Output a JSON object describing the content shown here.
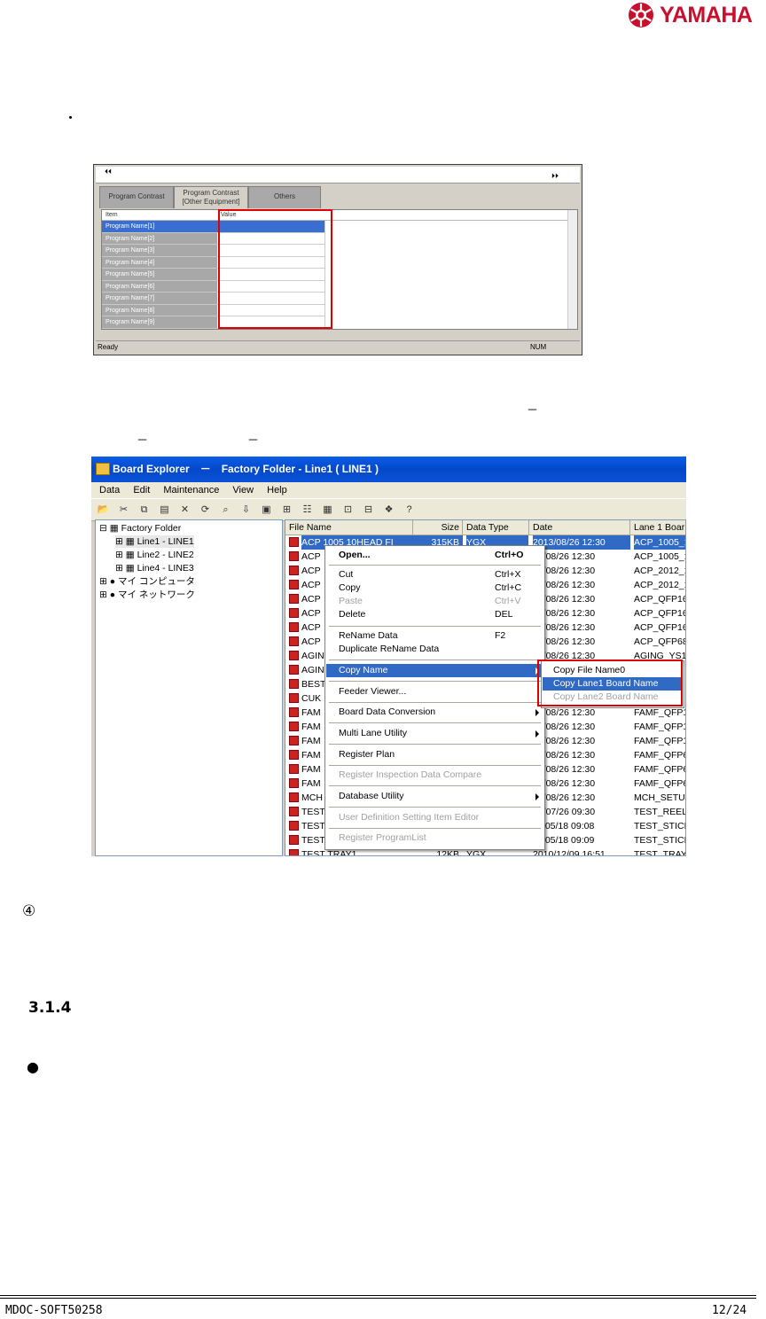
{
  "header": {
    "logo_text": "YAMAHA",
    "logo_icon": "tuning-forks-emblem",
    "brand_color": "#c8102e"
  },
  "body": {
    "bullet1": "・",
    "step_marker": "④",
    "section_number": "3.1.4",
    "bullet2": "●",
    "dash1": "－",
    "dash2": "－",
    "dash3": "－"
  },
  "screenshot1": {
    "tabs": [
      "Program Contrast",
      "Program Contrast\n[Other Equipment]",
      "Others"
    ],
    "col_item": "Item",
    "col_value": "Value",
    "rows": [
      "Program Name[1]",
      "Program Name[2]",
      "Program Name[3]",
      "Program Name[4]",
      "Program Name[5]",
      "Program Name[6]",
      "Program Name[7]",
      "Program Name[8]",
      "Program Name[9]"
    ],
    "status": "Ready",
    "status_num": "NUM"
  },
  "screenshot2": {
    "title": "Board Explorer　－　Factory Folder - Line1 ( LINE1 )",
    "menu": [
      "Data",
      "Edit",
      "Maintenance",
      "View",
      "Help"
    ],
    "tree": {
      "root": "Factory Folder",
      "lines": [
        "Line1 - LINE1",
        "Line2 - LINE2",
        "Line4 - LINE3"
      ],
      "my_computer": "マイ コンピュータ",
      "my_network": "マイ ネットワーク"
    },
    "columns": [
      "File Name",
      "Size",
      "Data Type",
      "Date",
      "Lane 1 Boar"
    ],
    "rows": [
      {
        "name": "ACP 1005 10HEAD FI",
        "size": "315KB",
        "type": "YGX",
        "date": "2013/08/26 12:30",
        "board": "ACP_1005_10"
      },
      {
        "name": "ACP",
        "date": "13/08/26 12:30",
        "board": "ACP_1005_10"
      },
      {
        "name": "ACP",
        "date": "13/08/26 12:30",
        "board": "ACP_2012_10"
      },
      {
        "name": "ACP",
        "date": "13/08/26 12:30",
        "board": "ACP_2012_10"
      },
      {
        "name": "ACP",
        "date": "13/08/26 12:30",
        "board": "ACP_QFP16"
      },
      {
        "name": "ACP",
        "date": "13/08/26 12:30",
        "board": "ACP_QFP16"
      },
      {
        "name": "ACP",
        "date": "13/08/26 12:30",
        "board": "ACP_QFP16"
      },
      {
        "name": "ACP",
        "date": "13/08/26 12:30",
        "board": "ACP_QFP68"
      },
      {
        "name": "AGIN",
        "date": "13/08/26 12:30",
        "board": "AGING_YS12"
      },
      {
        "name": "AGIN",
        "date": "",
        "board": ""
      },
      {
        "name": "BEST",
        "date": "",
        "board": ""
      },
      {
        "name": "CUK",
        "date": "",
        "board": ""
      },
      {
        "name": "FAM",
        "date": "13/08/26 12:30",
        "board": "FAMF_QFP1"
      },
      {
        "name": "FAM",
        "date": "13/08/26 12:30",
        "board": "FAMF_QFP1"
      },
      {
        "name": "FAM",
        "date": "13/08/26 12:30",
        "board": "FAMF_QFP1"
      },
      {
        "name": "FAM",
        "date": "13/08/26 12:30",
        "board": "FAMF_QFP6"
      },
      {
        "name": "FAM",
        "date": "13/08/26 12:30",
        "board": "FAMF_QFP6"
      },
      {
        "name": "FAM",
        "date": "13/08/26 12:30",
        "board": "FAMF_QFP6"
      },
      {
        "name": "MCH",
        "date": "13/08/26 12:30",
        "board": "MCH_SETUF"
      },
      {
        "name": "TEST",
        "date": "13/07/26 09:30",
        "board": "TEST_REEL_"
      },
      {
        "name": "TEST",
        "date": "11/05/18 09:08",
        "board": "TEST_STICK"
      },
      {
        "name": "TEST",
        "date": "11/05/18 09:09",
        "board": "TEST_STICK"
      },
      {
        "name": "TEST TRAY1",
        "size": "12KB",
        "type": "YGX",
        "date": "2010/12/09 16:51",
        "board": "TEST_TRAY"
      }
    ],
    "context_menu": [
      {
        "label": "Open...",
        "shortcut": "Ctrl+O"
      },
      {
        "label": "Cut",
        "shortcut": "Ctrl+X"
      },
      {
        "label": "Copy",
        "shortcut": "Ctrl+C"
      },
      {
        "label": "Paste",
        "shortcut": "Ctrl+V"
      },
      {
        "label": "Delete",
        "shortcut": "DEL"
      },
      {
        "label": "ReName Data",
        "shortcut": "F2"
      },
      {
        "label": "Duplicate ReName Data"
      },
      {
        "label": "Copy Name"
      },
      {
        "label": "Feeder Viewer..."
      },
      {
        "label": "Board Data Conversion"
      },
      {
        "label": "Multi Lane Utility"
      },
      {
        "label": "Register Plan"
      },
      {
        "label": "Register Inspection Data Compare"
      },
      {
        "label": "Database Utility"
      },
      {
        "label": "User Definition Setting Item Editor"
      },
      {
        "label": "Register ProgramList"
      }
    ],
    "submenu": [
      "Copy File Name0",
      "Copy Lane1 Board Name",
      "Copy Lane2 Board Name"
    ]
  },
  "footer": {
    "doc_id": "MDOC-SOFT50258",
    "page": "12/24"
  }
}
